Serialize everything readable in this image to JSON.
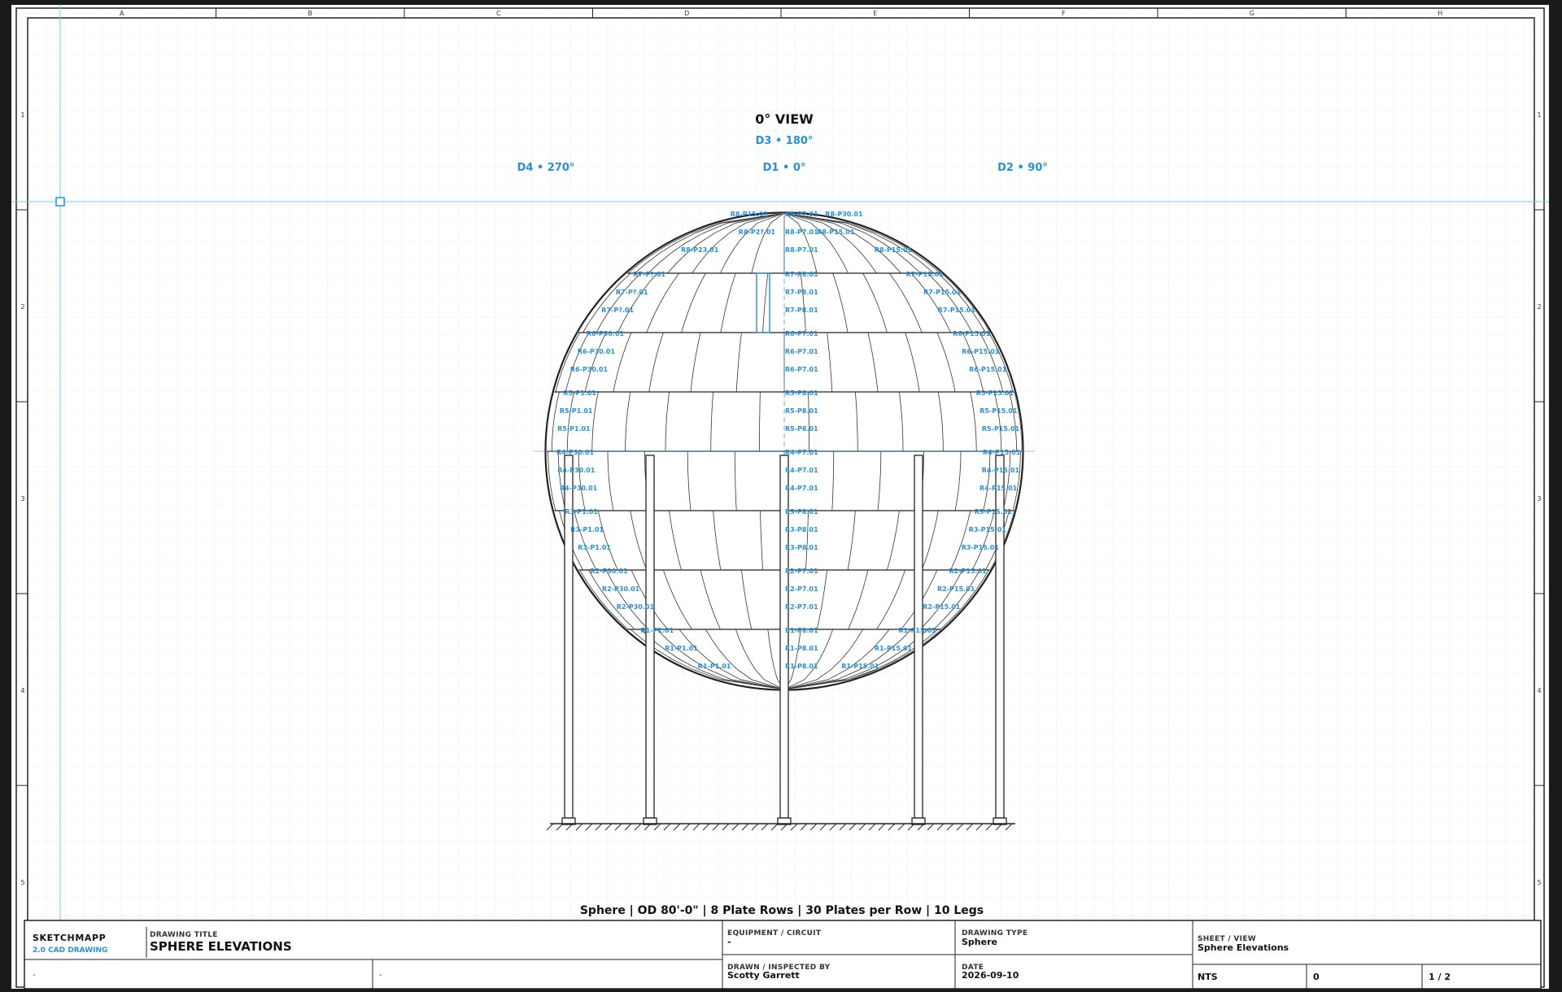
{
  "view_title": "0° VIEW",
  "directions": {
    "d3": "D3 • 180°",
    "d4": "D4 • 270°",
    "d1": "D1 • 0°",
    "d2": "D2 • 90°"
  },
  "caption": "Sphere | OD 80'-0\" | 8 Plate Rows | 30 Plates per Row | 10 Legs",
  "columns": [
    "A",
    "B",
    "C",
    "D",
    "E",
    "F",
    "G",
    "H"
  ],
  "rows": [
    "1",
    "2",
    "3",
    "4",
    "5"
  ],
  "plate_rows": [
    {
      "row": "R8",
      "left": [
        "R8-P30.01",
        "R8-P2?.01",
        "R8-P23.01"
      ],
      "center": [
        "R8-P7.01",
        "R8-P7.01",
        "R8-P7.01"
      ],
      "right": [
        "R8-P15.01",
        "R8-P15.01",
        "R8-P15.01"
      ]
    },
    {
      "row": "R7",
      "left": [
        "R7-P?.01",
        "R7-P?.01",
        "R7-P?.01"
      ],
      "center": [
        "R7-P8.01",
        "R7-P8.01",
        "R7-P8.01"
      ],
      "right": [
        "R7-P15.01",
        "R7-P15.01",
        "R7-P15.01"
      ]
    },
    {
      "row": "R6",
      "left": [
        "R6-P30.01",
        "R6-P30.01",
        "R6-P30.01"
      ],
      "center": [
        "R6-P7.01",
        "R6-P7.01",
        "R6-P7.01"
      ],
      "right": [
        "R6-P15.01",
        "R6-P15.01",
        "R6-P15.01"
      ]
    },
    {
      "row": "R5",
      "left": [
        "R5-P1.01",
        "R5-P1.01",
        "R5-P1.01"
      ],
      "center": [
        "R5-P8.01",
        "R5-P8.01",
        "R5-P8.01"
      ],
      "right": [
        "R5-P15.01",
        "R5-P15.01",
        "R5-P15.01"
      ]
    },
    {
      "row": "R4",
      "left": [
        "R4-P30.01",
        "R4-P30.01",
        "R4-P30.01"
      ],
      "center": [
        "R4-P7.01",
        "R4-P7.01",
        "R4-P7.01"
      ],
      "right": [
        "R4-P15.01",
        "R4-P15.01",
        "R4-P15.01"
      ]
    },
    {
      "row": "R3",
      "left": [
        "R3-P1.01",
        "R3-P1.01",
        "R3-P1.01"
      ],
      "center": [
        "R3-P8.01",
        "R3-P8.01",
        "R3-P8.01"
      ],
      "right": [
        "R3-P15.01",
        "R3-P15.01",
        "R3-P15.01"
      ]
    },
    {
      "row": "R2",
      "left": [
        "R2-P30.01",
        "R2-P30.01",
        "R2-P30.01"
      ],
      "center": [
        "R2-P7.01",
        "R2-P7.01",
        "R2-P7.01"
      ],
      "right": [
        "R2-P15.01",
        "R2-P15.01",
        "R2-P15.01"
      ]
    },
    {
      "row": "R1",
      "left": [
        "R1-P1.01",
        "R1-P1.01",
        "R1-P1.01"
      ],
      "center": [
        "R1-P8.01",
        "R1-P8.01",
        "R1-P8.01"
      ],
      "right": [
        "R1-P15.01",
        "R1-P15.01",
        "R1-P15.01"
      ]
    }
  ],
  "title_block": {
    "brand": "SKETCHMAPP",
    "brand_sub": "2.0 CAD DRAWING",
    "drawing_title_label": "DRAWING TITLE",
    "drawing_title": "SPHERE ELEVATIONS",
    "equipment_label": "EQUIPMENT / CIRCUIT",
    "equipment_value": "-",
    "drawing_type_label": "DRAWING TYPE",
    "drawing_type_value": "Sphere",
    "sheet_view_label": "SHEET / VIEW",
    "sheet_view_value": "Sphere Elevations",
    "drawn_label": "DRAWN / INSPECTED BY",
    "drawn_value": "Scotty Garrett",
    "date_label": "DATE",
    "date_value": "2026-09-10",
    "field_a": "-",
    "field_b": "-",
    "scale": "NTS",
    "revision": "0",
    "sheet_no": "1 / 2"
  },
  "colors": {
    "accent": "#2a8fd6",
    "line": "#222222",
    "paper": "#ffffff",
    "grid": "#e6eef5"
  }
}
